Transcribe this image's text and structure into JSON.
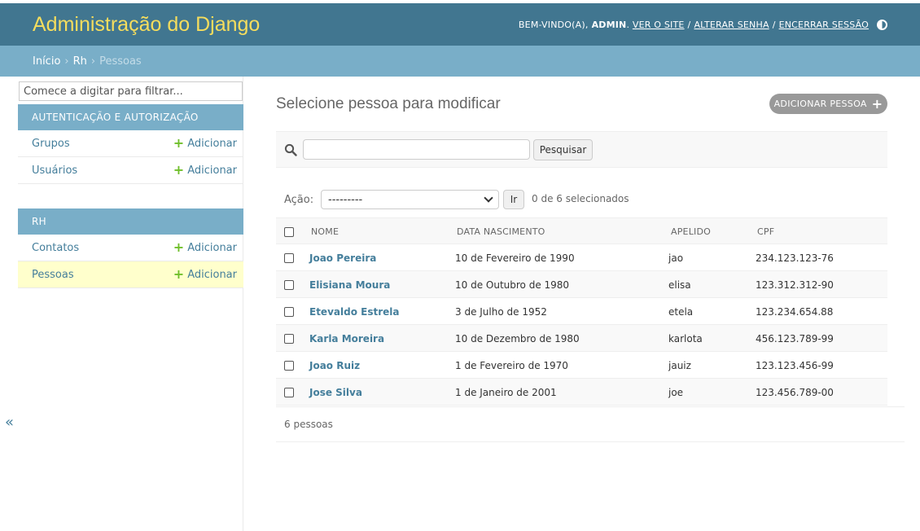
{
  "header": {
    "branding": "Administração do Django",
    "welcome": "BEM-VINDO(A),",
    "user": "ADMIN",
    "view_site": "VER O SITE",
    "change_password": "ALTERAR SENHA",
    "logout": "ENCERRAR SESSÃO"
  },
  "breadcrumbs": {
    "home": "Início",
    "app": "Rh",
    "current": "Pessoas"
  },
  "sidebar": {
    "filter_placeholder": "Comece a digitar para filtrar...",
    "apps": [
      {
        "caption": "AUTENTICAÇÃO E AUTORIZAÇÃO",
        "models": [
          {
            "name": "Grupos",
            "add": "Adicionar"
          },
          {
            "name": "Usuários",
            "add": "Adicionar"
          }
        ]
      },
      {
        "caption": "RH",
        "models": [
          {
            "name": "Contatos",
            "add": "Adicionar"
          },
          {
            "name": "Pessoas",
            "add": "Adicionar"
          }
        ]
      }
    ],
    "collapse": "«"
  },
  "content": {
    "title": "Selecione pessoa para modificar",
    "add_button": "ADICIONAR PESSOA",
    "search_button": "Pesquisar",
    "action_label": "Ação:",
    "action_value": "---------",
    "go_button": "Ir",
    "counter": "0 de 6 selecionados",
    "columns": [
      "NOME",
      "DATA NASCIMENTO",
      "APELIDO",
      "CPF"
    ],
    "rows": [
      {
        "nome": "Joao Pereira",
        "data": "10 de Fevereiro de 1990",
        "apelido": "jao",
        "cpf": "234.123.123-76"
      },
      {
        "nome": "Elisiana Moura",
        "data": "10 de Outubro de 1980",
        "apelido": "elisa",
        "cpf": "123.312.312-90"
      },
      {
        "nome": "Etevaldo Estrela",
        "data": "3 de Julho de 1952",
        "apelido": "etela",
        "cpf": "123.234.654.88"
      },
      {
        "nome": "Karla Moreira",
        "data": "10 de Dezembro de 1980",
        "apelido": "karlota",
        "cpf": "456.123.789-99"
      },
      {
        "nome": "Joao Ruiz",
        "data": "1 de Fevereiro de 1970",
        "apelido": "jauiz",
        "cpf": "123.123.456-99"
      },
      {
        "nome": "Jose Silva",
        "data": "1 de Janeiro de 2001",
        "apelido": "joe",
        "cpf": "123.456.789-00"
      }
    ],
    "paginator": "6 pessoas"
  },
  "colors": {
    "header_bg": "#417690",
    "branding": "#f5dd5d",
    "breadcrumb_bg": "#79aec8",
    "link": "#447e9b",
    "add_green": "#70bf2b",
    "active_row": "#ffffcc"
  }
}
